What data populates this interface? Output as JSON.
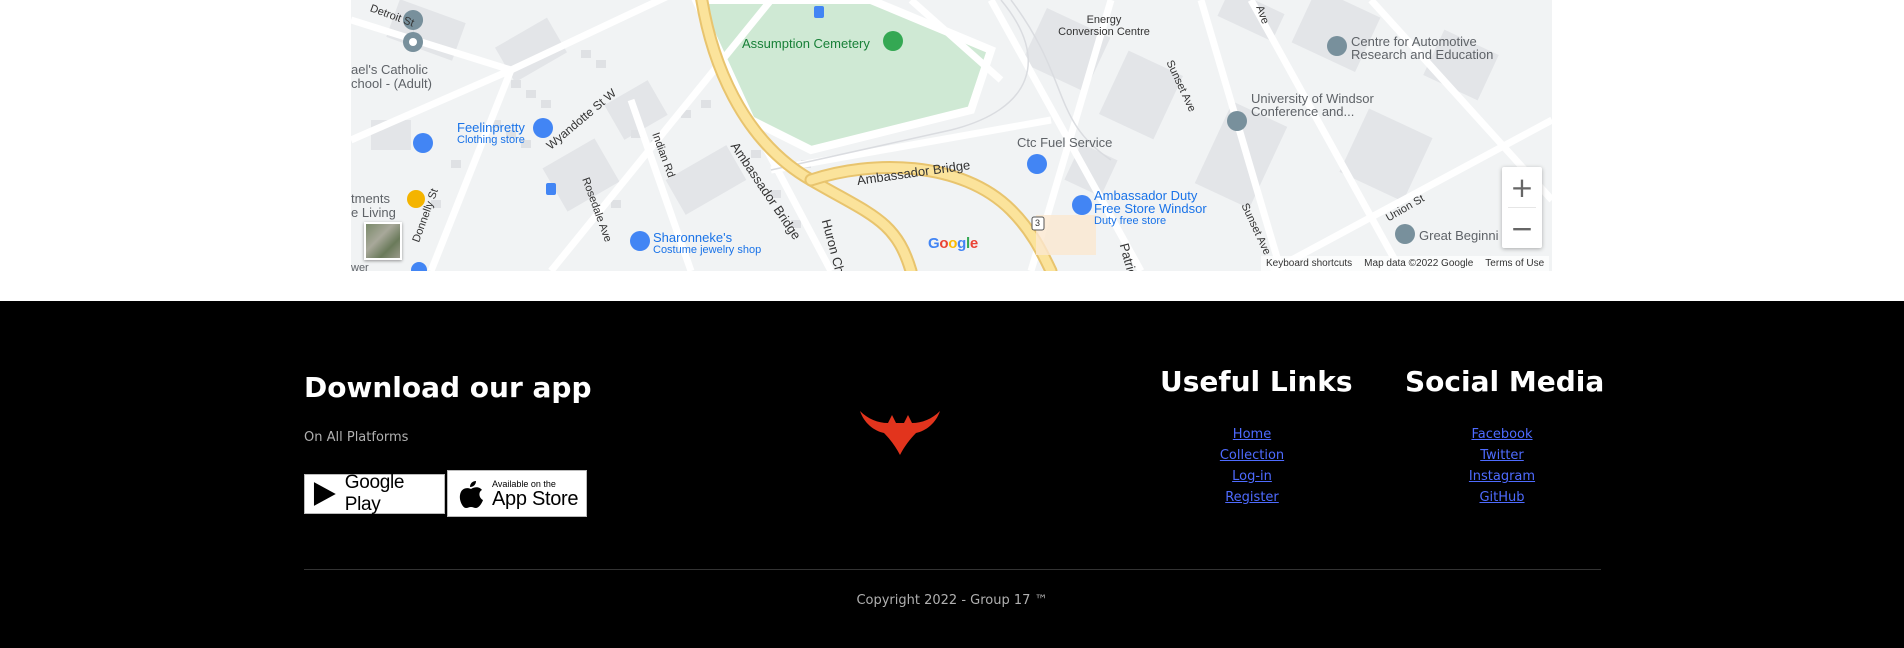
{
  "map": {
    "pois": {
      "assumption_cemetery": "Assumption Cemetery",
      "energy_centre_line1": "Energy",
      "energy_centre_line2": "Conversion Centre",
      "automotive_line1": "Centre for Automotive",
      "automotive_line2": "Research and Education",
      "uwindsor_line1": "University of Windsor",
      "uwindsor_line2": "Conference and...",
      "ctc_fuel": "Ctc Fuel Service",
      "duty_free_line1": "Ambassador Duty",
      "duty_free_line2": "Free Store Windsor",
      "duty_free_sub": "Duty free store",
      "great_beginning": "Great Beginni",
      "feelinpretty": "Feelinpretty",
      "feelinpretty_sub": "Clothing store",
      "sharonneke": "Sharonneke's",
      "sharonneke_sub": "Costume jewelry shop",
      "catholic_line1": "ael's Catholic",
      "catholic_line2": "chool - (Adult)",
      "tments_line1": "tments",
      "tments_line2": "e Living",
      "wer": "wer"
    },
    "streets": {
      "detroit_st": "Detroit St",
      "wyandotte": "Wyandotte St W",
      "indian_rd": "Indian Rd",
      "rosedale": "Rosedale Ave",
      "donnelly": "Donnelly St",
      "ambassador_bridge_1": "Ambassador Bridge",
      "ambassador_bridge_2": "Ambassador Bridge",
      "huron_church": "Huron Chu",
      "patrick": "Patric",
      "sunset_ave_1": "Sunset Ave",
      "sunset_ave_2": "Sunset Ave",
      "union_st": "Union St",
      "ave_top": "Ave",
      "route_3": "3"
    },
    "zoom_in": "+",
    "zoom_out": "−",
    "logo": "Google",
    "attribution": {
      "shortcuts": "Keyboard shortcuts",
      "map_data": "Map data ©2022 Google",
      "terms": "Terms of Use"
    }
  },
  "footer": {
    "download_title": "Download our app",
    "download_subtitle": "On All Platforms",
    "google_play": "Google Play",
    "app_store_small": "Available on the",
    "app_store_big": "App Store",
    "logo_color": "#e2341d",
    "useful_links": {
      "title": "Useful Links",
      "items": [
        "Home",
        "Collection",
        "Log-in",
        "Register"
      ]
    },
    "social_media": {
      "title": "Social Media",
      "items": [
        "Facebook",
        "Twitter",
        "Instagram",
        "GitHub"
      ]
    },
    "copyright": "Copyright 2022 - Group 17 ™",
    "link_color": "#4e6bff"
  }
}
